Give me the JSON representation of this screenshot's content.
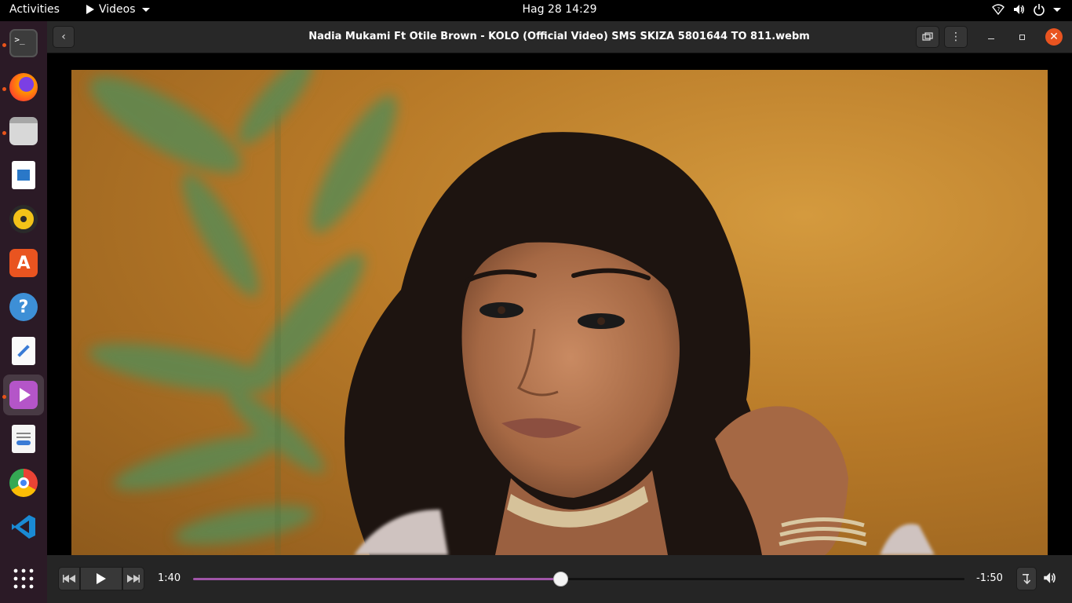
{
  "topbar": {
    "activities": "Activities",
    "app_name": "Videos",
    "clock": "Hag 28  14:29"
  },
  "dock": {
    "items": [
      {
        "name": "terminal",
        "running": true
      },
      {
        "name": "firefox",
        "running": true
      },
      {
        "name": "files",
        "running": true
      },
      {
        "name": "writer",
        "running": false
      },
      {
        "name": "rhythmbox",
        "running": false
      },
      {
        "name": "software",
        "running": false
      },
      {
        "name": "help",
        "running": false
      },
      {
        "name": "text-editor",
        "running": false
      },
      {
        "name": "videos",
        "running": true,
        "active": true
      },
      {
        "name": "document-viewer",
        "running": false
      },
      {
        "name": "chrome",
        "running": false
      },
      {
        "name": "vscode",
        "running": false
      },
      {
        "name": "app-grid",
        "running": false
      }
    ]
  },
  "window": {
    "title": "Nadia Mukami Ft Otile Brown - KOLO (Official Video) SMS SKIZA 5801644 TO 811.webm"
  },
  "player": {
    "elapsed": "1:40",
    "remaining": "-1:50",
    "progress_fraction": 0.477
  },
  "colors": {
    "accent": "#e95420",
    "progress": "#a055a8",
    "dock_bg": "#2b1a26"
  }
}
